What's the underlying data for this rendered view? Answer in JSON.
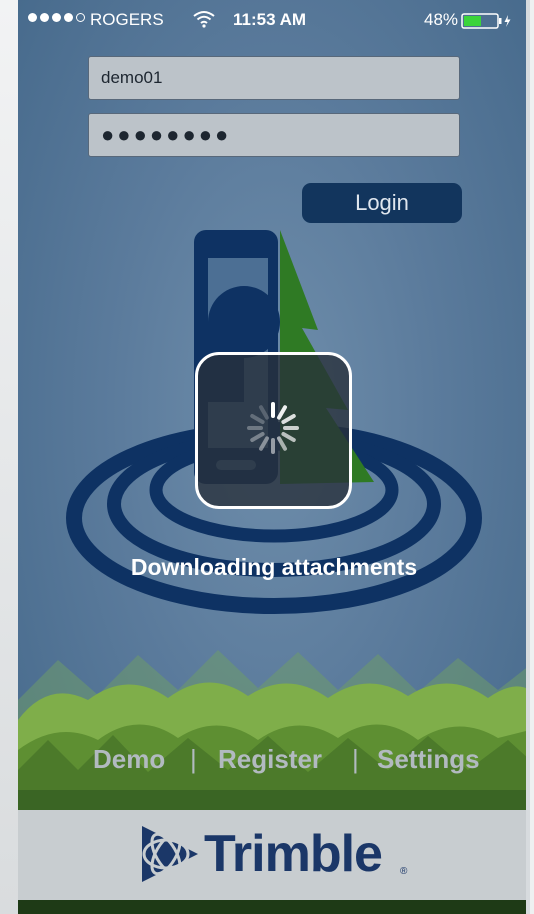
{
  "status_bar": {
    "carrier": "ROGERS",
    "time": "11:53 AM",
    "battery": "48%",
    "icons": [
      "signal-icon",
      "wifi-icon",
      "battery-icon",
      "charging-icon"
    ]
  },
  "login": {
    "username_value": "demo01",
    "password_value": "●●●●●●●●",
    "login_label": "Login"
  },
  "loading": {
    "message": "Downloading attachments",
    "icon": "spinner-icon"
  },
  "footer_links": {
    "demo": "Demo",
    "separator": "|",
    "register": "Register",
    "settings": "Settings"
  },
  "brand": {
    "name": "Trimble",
    "registered": "®"
  },
  "colors": {
    "background": "#5b7b9c",
    "login_button": "#12355d",
    "brand_blue": "#1b3768",
    "tree_green": "#2f7a24"
  }
}
